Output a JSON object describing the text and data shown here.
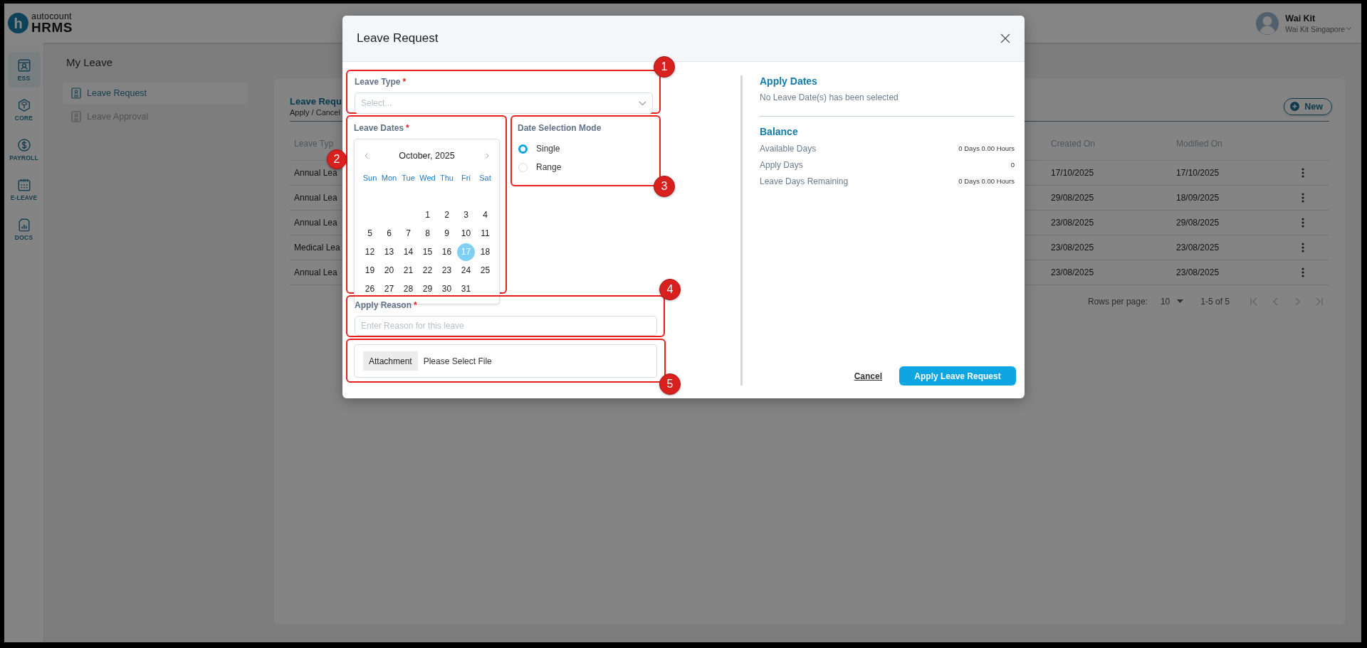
{
  "header": {
    "logo_letter": "h",
    "brand": "autocount",
    "product": "HRMS",
    "user_name": "Wai Kit",
    "company": "Wai Kit Singapore"
  },
  "nav_rail": [
    {
      "label": "ESS",
      "selected": true
    },
    {
      "label": "CORE",
      "selected": false
    },
    {
      "label": "PAYROLL",
      "selected": false
    },
    {
      "label": "E-LEAVE",
      "selected": false
    },
    {
      "label": "DOCS",
      "selected": false
    }
  ],
  "page_title": "My Leave",
  "subnav": [
    {
      "label": "Leave Request",
      "selected": true
    },
    {
      "label": "Leave Approval",
      "selected": false
    }
  ],
  "card": {
    "title": "Leave Requ",
    "subtitle": "Apply / Cancel",
    "new_button": "New"
  },
  "table": {
    "columns": [
      "Leave Typ",
      "Created On",
      "Modified On"
    ],
    "rows": [
      {
        "leave_type": "Annual Lea",
        "created_on": "17/10/2025",
        "modified_on": "17/10/2025"
      },
      {
        "leave_type": "Annual Lea",
        "created_on": "29/08/2025",
        "modified_on": "18/09/2025"
      },
      {
        "leave_type": "Annual Lea",
        "created_on": "23/08/2025",
        "modified_on": "29/08/2025"
      },
      {
        "leave_type": "Medical Lea",
        "created_on": "23/08/2025",
        "modified_on": "23/08/2025"
      },
      {
        "leave_type": "Annual Lea",
        "created_on": "23/08/2025",
        "modified_on": "23/08/2025"
      }
    ]
  },
  "pagination": {
    "rows_per_page_label": "Rows per page:",
    "rows_per_page": "10",
    "range": "1-5 of 5"
  },
  "modal": {
    "title": "Leave Request",
    "leave_type": {
      "label": "Leave Type",
      "required_mark": "*",
      "placeholder": "Select...",
      "annotation": "1"
    },
    "leave_dates": {
      "label": "Leave Dates",
      "required_mark": "*",
      "annotation": "2",
      "calendar": {
        "month": "October, 2025",
        "weekdays": [
          "Sun",
          "Mon",
          "Tue",
          "Wed",
          "Thu",
          "Fri",
          "Sat"
        ],
        "weeks": [
          [
            {
              "day": "1",
              "selected": false
            },
            {
              "day": "2",
              "selected": false
            },
            {
              "day": "3",
              "selected": false
            },
            {
              "day": "4",
              "selected": false
            }
          ],
          [
            {
              "day": "5",
              "selected": false
            },
            {
              "day": "6",
              "selected": false
            },
            {
              "day": "7",
              "selected": false
            },
            {
              "day": "8",
              "selected": false
            },
            {
              "day": "9",
              "selected": false
            },
            {
              "day": "10",
              "selected": false
            },
            {
              "day": "11",
              "selected": false
            }
          ],
          [
            {
              "day": "12",
              "selected": false
            },
            {
              "day": "13",
              "selected": false
            },
            {
              "day": "14",
              "selected": false
            },
            {
              "day": "15",
              "selected": false
            },
            {
              "day": "16",
              "selected": false
            },
            {
              "day": "17",
              "selected": true
            },
            {
              "day": "18",
              "selected": false
            }
          ],
          [
            {
              "day": "19",
              "selected": false
            },
            {
              "day": "20",
              "selected": false
            },
            {
              "day": "21",
              "selected": false
            },
            {
              "day": "22",
              "selected": false
            },
            {
              "day": "23",
              "selected": false
            },
            {
              "day": "24",
              "selected": false
            },
            {
              "day": "25",
              "selected": false
            }
          ],
          [
            {
              "day": "26",
              "selected": false
            },
            {
              "day": "27",
              "selected": false
            },
            {
              "day": "28",
              "selected": false
            },
            {
              "day": "29",
              "selected": false
            },
            {
              "day": "30",
              "selected": false
            },
            {
              "day": "31",
              "selected": false
            }
          ]
        ]
      }
    },
    "mode": {
      "label": "Date Selection Mode",
      "annotation": "3",
      "options": [
        {
          "label": "Single",
          "selected": true
        },
        {
          "label": "Range",
          "selected": false
        }
      ]
    },
    "reason": {
      "label": "Apply Reason",
      "required_mark": "*",
      "placeholder": "Enter Reason for this leave",
      "annotation": "4"
    },
    "attachment": {
      "button": "Attachment",
      "file": "Please Select File",
      "annotation": "5"
    },
    "summary": {
      "apply_dates_title": "Apply Dates",
      "apply_dates_text": "No Leave Date(s) has been selected",
      "balance_title": "Balance",
      "balance_rows": [
        {
          "label": "Available Days",
          "value": "0 Days 0.00 Hours"
        },
        {
          "label": "Apply Days",
          "value": "0"
        },
        {
          "label": "Leave Days Remaining",
          "value": "0 Days 0.00 Hours"
        }
      ]
    },
    "cancel": "Cancel",
    "submit": "Apply Leave Request"
  }
}
